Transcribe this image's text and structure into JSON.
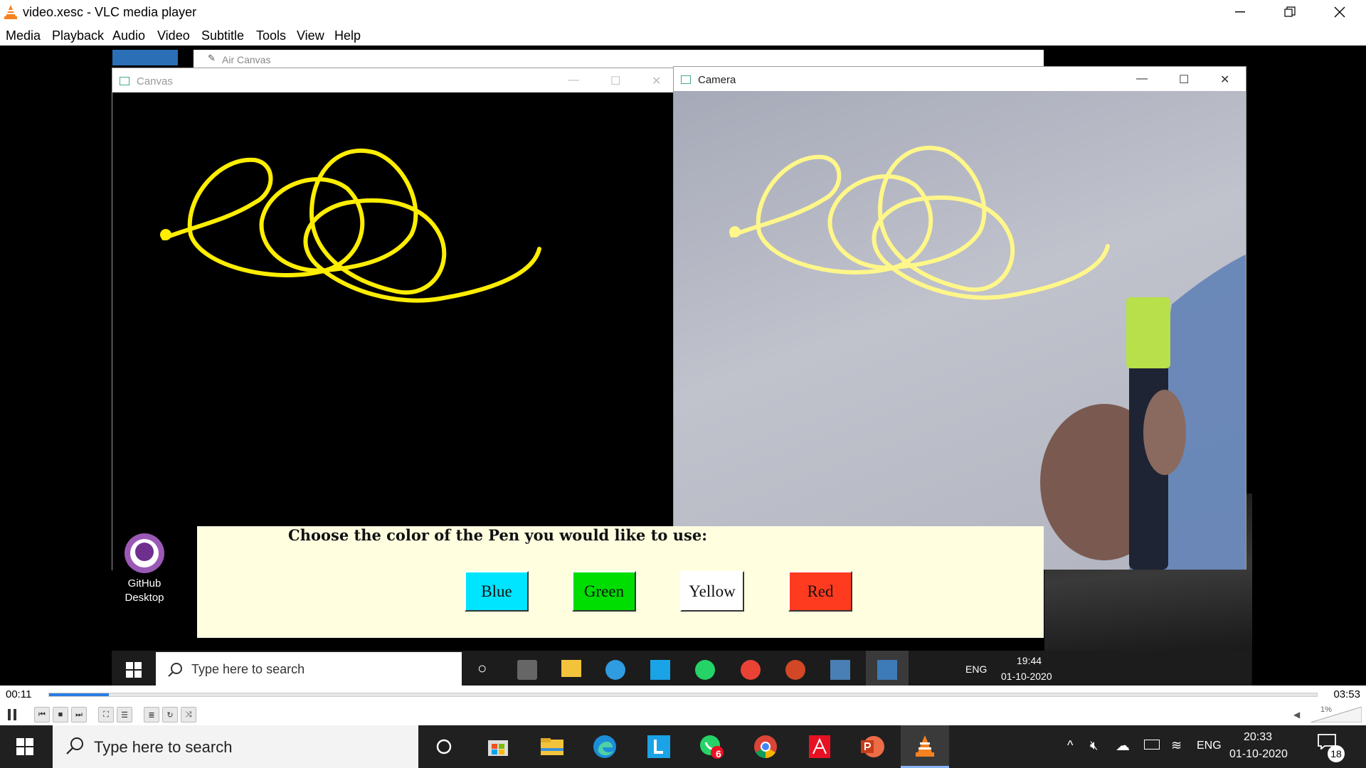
{
  "window": {
    "title": "video.xesc - VLC media player"
  },
  "menu": [
    "Media",
    "Playback",
    "Audio",
    "Video",
    "Subtitle",
    "Tools",
    "View",
    "Help"
  ],
  "inner_windows": {
    "air_canvas_title": "Air Canvas",
    "canvas_title": "Canvas",
    "camera_title": "Camera"
  },
  "color_panel": {
    "prompt": "Choose the color of the Pen you would like to use:",
    "buttons": [
      {
        "label": "Blue",
        "color": "#00e5ff"
      },
      {
        "label": "Green",
        "color": "#00dd00"
      },
      {
        "label": "Yellow",
        "color": "#ffffff"
      },
      {
        "label": "Red",
        "color": "#ff3b1f"
      }
    ]
  },
  "desktop": {
    "github_label_line1": "GitHub",
    "github_label_line2": "Desktop"
  },
  "inner_taskbar": {
    "search_placeholder": "Type here to search",
    "lang": "ENG",
    "time": "19:44",
    "date": "01-10-2020"
  },
  "player": {
    "elapsed": "00:11",
    "total": "03:53",
    "progress_fraction": 0.047,
    "volume_label": "1%"
  },
  "taskbar": {
    "search_placeholder": "Type here to search",
    "lang": "ENG",
    "time": "20:33",
    "date": "01-10-2020",
    "whatsapp_badge": "6",
    "notification_count": "18"
  },
  "colors": {
    "stroke_yellow": "#ffee00",
    "accent_blue": "#2a7de1"
  }
}
